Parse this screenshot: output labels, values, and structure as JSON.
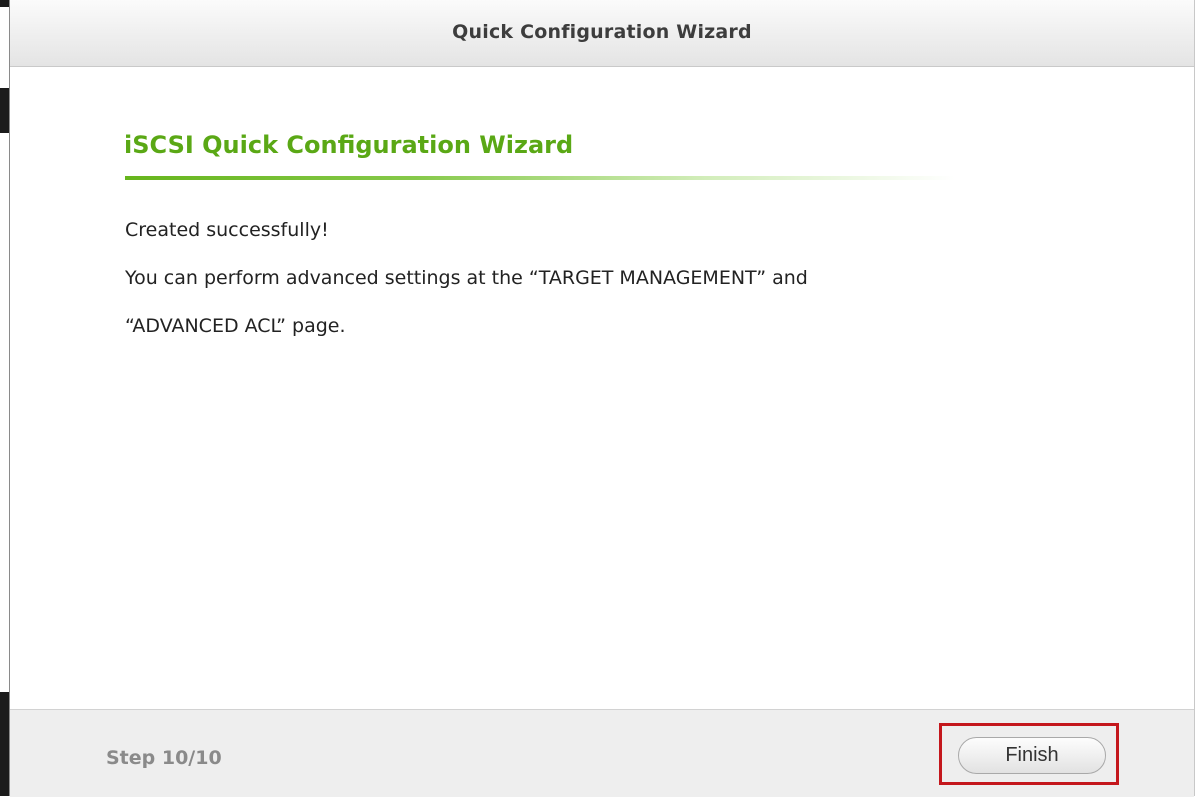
{
  "window": {
    "title": "Quick Configuration Wizard"
  },
  "content": {
    "heading": "iSCSI Quick Configuration Wizard",
    "lines": [
      "Created successfully!",
      "You can perform advanced settings at the “TARGET MANAGEMENT” and",
      "“ADVANCED ACL” page."
    ]
  },
  "footer": {
    "step": "Step 10/10",
    "finish_label": "Finish"
  },
  "colors": {
    "heading": "#5aa815",
    "highlight_box": "#c4171c",
    "footer_bg": "#eeeeee"
  }
}
